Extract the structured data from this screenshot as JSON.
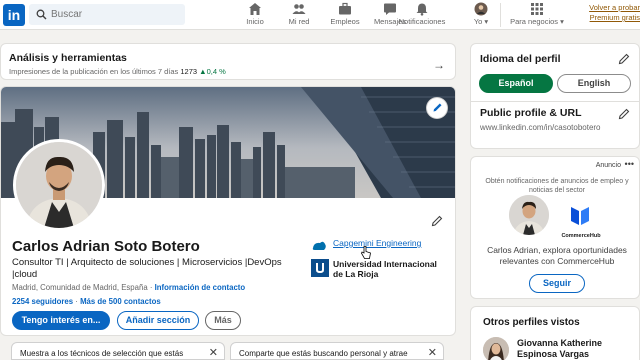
{
  "nav": {
    "logo": "in",
    "search_placeholder": "Buscar",
    "items": [
      {
        "label": "Inicio",
        "icon": "home-icon"
      },
      {
        "label": "Mi red",
        "icon": "network-icon"
      },
      {
        "label": "Empleos",
        "icon": "briefcase-icon"
      },
      {
        "label": "Mensajes",
        "icon": "messaging-icon"
      },
      {
        "label": "Notificaciones",
        "icon": "bell-icon"
      },
      {
        "label": "Yo",
        "icon": "avatar-icon"
      },
      {
        "label": "Para negocios",
        "icon": "grid-icon"
      }
    ],
    "premium_line1": "Volver a probar",
    "premium_line2": "Premium gratis"
  },
  "analytics": {
    "title": "Análisis y herramientas",
    "subtitle": "Impresiones de la publicación en los últimos 7 días",
    "impressions": "1273",
    "change": "0,4 %"
  },
  "profile": {
    "name": "Carlos Adrian Soto Botero",
    "headline": "Consultor TI | Arquitecto de soluciones | Microservicios |DevOps |cloud",
    "location": "Madrid, Comunidad de Madrid, España",
    "contact_link": "Información de contacto",
    "followers": "2254 seguidores",
    "connections": "Más de 500 contactos",
    "separator": "·",
    "btn_open_to": "Tengo interés en...",
    "btn_add_section": "Añadir sección",
    "btn_more": "Más",
    "company": "Capgemini Engineering",
    "university_line1": "Universidad Internacional",
    "university_line2": "de La Rioja"
  },
  "recommendations": [
    {
      "text": "Muestra a los técnicos de selección que estás"
    },
    {
      "text": "Comparte que estás buscando personal y atrae"
    }
  ],
  "sidebar": {
    "language_title": "Idioma del perfil",
    "lang_es": "Español",
    "lang_en": "English",
    "url_title": "Public profile & URL",
    "url": "www.linkedin.com/in/casotobotero",
    "ad_label": "Anuncio",
    "ad_dots": "•••",
    "ad_text": "Obtén notificaciones de anuncios de empleo y noticias del sector",
    "ad_company_logo_name": "CommerceHub",
    "ad_body": "Carlos Adrian, explora oportunidades relevantes con CommerceHub",
    "follow_btn": "Seguir",
    "others_title": "Otros perfiles vistos",
    "other_name_line1": "Giovanna Katherine",
    "other_name_line2": "Espinosa Vargas"
  },
  "colors": {
    "brand": "#0a66c2",
    "language_active": "#057642",
    "premium": "#915907"
  }
}
